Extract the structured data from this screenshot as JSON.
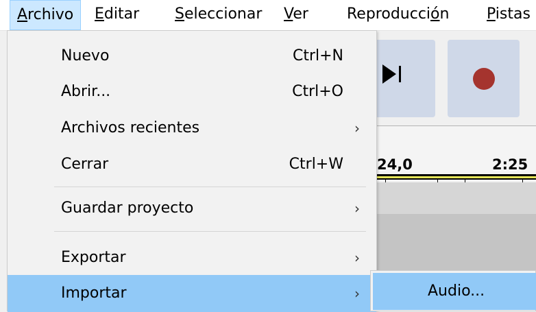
{
  "menubar": {
    "items": [
      {
        "pre": "",
        "ul": "A",
        "post": "rchivo"
      },
      {
        "pre": "",
        "ul": "E",
        "post": "ditar"
      },
      {
        "pre": "",
        "ul": "S",
        "post": "eleccionar"
      },
      {
        "pre": "",
        "ul": "V",
        "post": "er"
      },
      {
        "pre": "Reproducci",
        "ul": "ó",
        "post": "n"
      },
      {
        "pre": "",
        "ul": "P",
        "post": "istas"
      }
    ]
  },
  "toolbar": {
    "skip_end_icon": "skip-to-end-icon",
    "record_icon": "record-icon",
    "record_color": "#a5342e"
  },
  "ruler": {
    "labels": [
      "24,0",
      "2:25"
    ]
  },
  "file_menu": {
    "items": [
      {
        "label": "Nuevo",
        "accel": "Ctrl+N",
        "submenu": false
      },
      {
        "label": "Abrir...",
        "accel": "Ctrl+O",
        "submenu": false
      },
      {
        "label": "Archivos recientes",
        "accel": "",
        "submenu": true
      },
      {
        "label": "Cerrar",
        "accel": "Ctrl+W",
        "submenu": false
      },
      {
        "label": "Guardar proyecto",
        "accel": "",
        "submenu": true
      },
      {
        "label": "Exportar",
        "accel": "",
        "submenu": true
      },
      {
        "label": "Importar",
        "accel": "",
        "submenu": true
      }
    ],
    "arrow": "›"
  },
  "import_submenu": {
    "items": [
      {
        "label": "Audio..."
      }
    ]
  },
  "colors": {
    "highlight": "#91c9f7",
    "menubar_active": "#cce8ff"
  }
}
